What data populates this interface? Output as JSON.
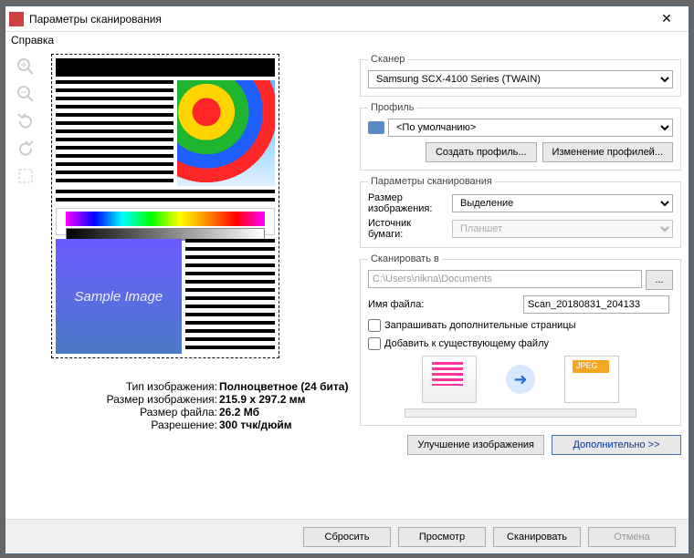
{
  "window": {
    "title": "Параметры сканирования",
    "menu_help": "Справка"
  },
  "scanner": {
    "legend": "Сканер",
    "device": "Samsung SCX-4100 Series (TWAIN)"
  },
  "profile": {
    "legend": "Профиль",
    "selected": "<По умолчанию>",
    "create_btn": "Создать профиль...",
    "edit_btn": "Изменение профилей..."
  },
  "params": {
    "legend": "Параметры сканирования",
    "size_label": "Размер изображения:",
    "size_value": "Выделение",
    "source_label": "Источник бумаги:",
    "source_value": "Планшет"
  },
  "scan_to": {
    "legend": "Сканировать в",
    "path": "C:\\Users\\nikna\\Documents",
    "browse": "...",
    "filename_label": "Имя файла:",
    "filename_value": "Scan_20180831_204133",
    "ask_more": "Запрашивать дополнительные страницы",
    "append_existing": "Добавить к существующему файлу"
  },
  "flow": {
    "jpeg_label": "JPEG"
  },
  "actions": {
    "enhance": "Улучшение изображения",
    "more": "Дополнительно >>"
  },
  "info": {
    "type_k": "Тип изображения:",
    "type_v": "Полноцветное (24 бита)",
    "size_k": "Размер изображения:",
    "size_v": "215.9 x 297.2 мм",
    "file_k": "Размер файла:",
    "file_v": "26.2 Мб",
    "res_k": "Разрешение:",
    "res_v": "300 тчк/дюйм"
  },
  "preview": {
    "sample": "Sample Image"
  },
  "footer": {
    "reset": "Сбросить",
    "preview": "Просмотр",
    "scan": "Сканировать",
    "cancel": "Отмена"
  }
}
